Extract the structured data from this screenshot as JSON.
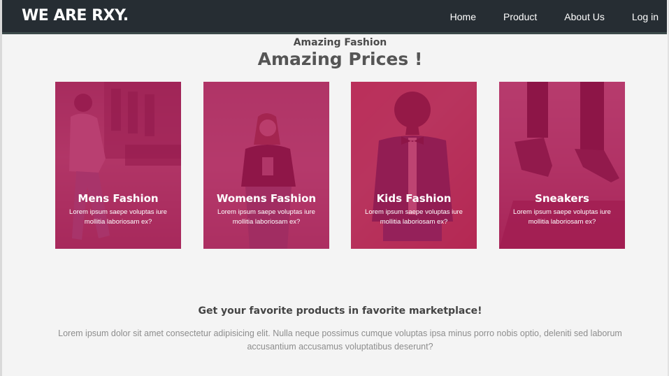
{
  "header": {
    "brand": "WE ARE RXY.",
    "nav": [
      "Home",
      "Product",
      "About Us",
      "Log in"
    ]
  },
  "hero": {
    "subtitle": "Amazing Fashion",
    "title": "Amazing Prices !"
  },
  "cards": [
    {
      "title": "Mens Fashion",
      "description": "Lorem ipsum saepe voluptas iure mollitia laboriosam ex?"
    },
    {
      "title": "Womens Fashion",
      "description": "Lorem ipsum saepe voluptas iure mollitia laboriosam ex?"
    },
    {
      "title": "Kids Fashion",
      "description": "Lorem ipsum saepe voluptas iure mollitia laboriosam ex?"
    },
    {
      "title": "Sneakers",
      "description": "Lorem ipsum saepe voluptas iure mollitia laboriosam ex?"
    }
  ],
  "section": {
    "title": "Get your favorite products in favorite marketplace!",
    "text": "Lorem ipsum dolor sit amet consectetur adipisicing elit. Nulla neque possimus cumque voluptas ipsa minus porro nobis optio, deleniti sed laborum accusantium accusamus voluptatibus deserunt?"
  },
  "colors": {
    "header_bg": "#262d33",
    "card_overlay": "#b01654",
    "page_bg": "#f4f4f4"
  }
}
